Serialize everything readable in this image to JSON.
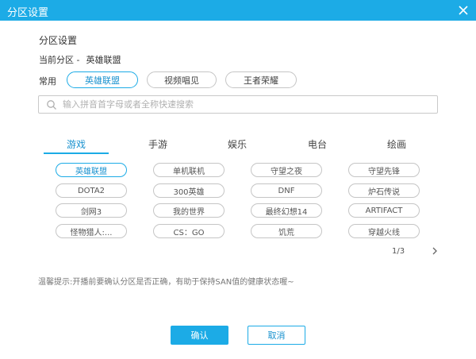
{
  "window": {
    "title": "分区设置"
  },
  "section_title": "分区设置",
  "current": {
    "label": "当前分区 -",
    "value": "英雄联盟"
  },
  "common": {
    "label": "常用",
    "items": [
      "英雄联盟",
      "视频唱见",
      "王者荣耀"
    ]
  },
  "search": {
    "placeholder": "输入拼音首字母或者全称快速搜索",
    "value": ""
  },
  "tabs": [
    "游戏",
    "手游",
    "娱乐",
    "电台",
    "绘画"
  ],
  "games": [
    "英雄联盟",
    "单机联机",
    "守望之夜",
    "守望先锋",
    "DOTA2",
    "300英雄",
    "DNF",
    "炉石传说",
    "剑网3",
    "我的世界",
    "最终幻想14",
    "ARTIFACT",
    "怪物猎人:...",
    "CS：GO",
    "饥荒",
    "穿越火线"
  ],
  "pager": {
    "text": "1/3"
  },
  "tip": "温馨提示:开播前要确认分区是否正确，有助于保持SAN值的健康状态喔~",
  "buttons": {
    "ok": "确认",
    "cancel": "取消"
  },
  "colors": {
    "accent": "#1cabe6",
    "border": "#c5c5c5"
  }
}
